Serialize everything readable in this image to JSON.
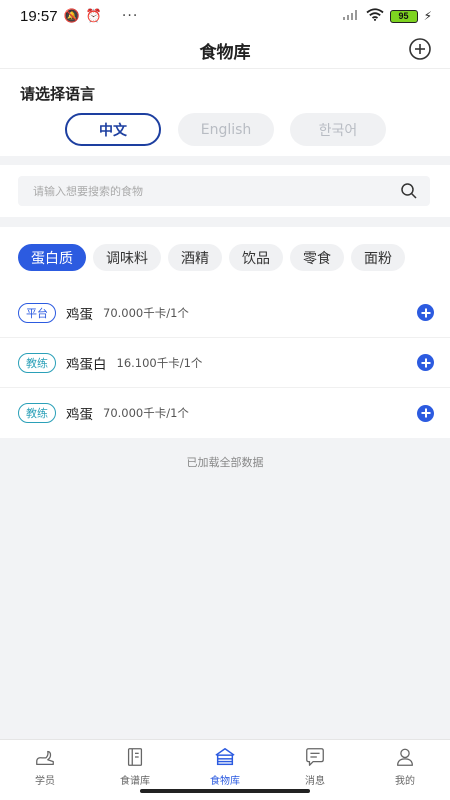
{
  "status_bar": {
    "time": "19:57",
    "battery": "95",
    "more": "···"
  },
  "header": {
    "title": "食物库"
  },
  "language": {
    "prompt": "请选择语言",
    "options": [
      {
        "label": "中文",
        "selected": true
      },
      {
        "label": "English",
        "selected": false
      },
      {
        "label": "한국어",
        "selected": false
      }
    ]
  },
  "search": {
    "placeholder": "请输入想要搜索的食物",
    "value": ""
  },
  "categories": [
    "蛋白质",
    "调味料",
    "酒精",
    "饮品",
    "零食",
    "面粉"
  ],
  "active_category": "蛋白质",
  "foods": [
    {
      "tag": "平台",
      "name": "鸡蛋",
      "calories": "70.000千卡/1个"
    },
    {
      "tag": "教练",
      "name": "鸡蛋白",
      "calories": "16.100千卡/1个"
    },
    {
      "tag": "教练",
      "name": "鸡蛋",
      "calories": "70.000千卡/1个"
    }
  ],
  "loaded_text": "已加载全部数据",
  "tabs": [
    {
      "label": "学员",
      "icon": "student-icon",
      "active": false
    },
    {
      "label": "食谱库",
      "icon": "recipe-book-icon",
      "active": false
    },
    {
      "label": "食物库",
      "icon": "food-library-icon",
      "active": true
    },
    {
      "label": "消息",
      "icon": "message-icon",
      "active": false
    },
    {
      "label": "我的",
      "icon": "profile-icon",
      "active": false
    }
  ],
  "colors": {
    "accent": "#2c5be0",
    "selected_language": "#1d3fa0",
    "coach_tag": "#2aa0b8"
  }
}
